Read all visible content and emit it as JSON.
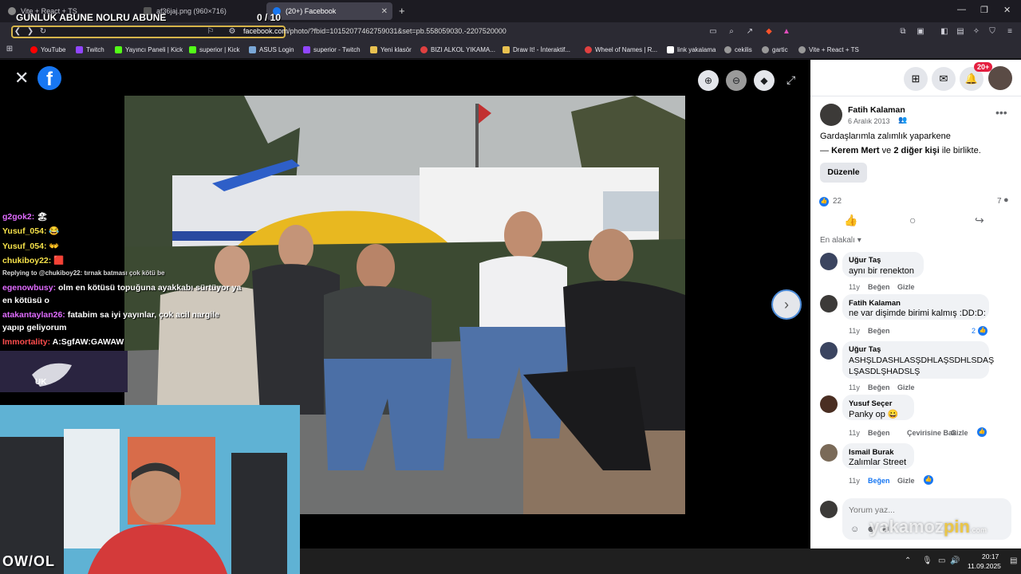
{
  "browser": {
    "tabs": [
      {
        "label": "Vite + React + TS",
        "icon": "github-icon"
      },
      {
        "label": "af36jaj.png (960×716)",
        "icon": "image-icon"
      },
      {
        "label": "(20+) Facebook",
        "icon": "facebook-icon",
        "active": true
      }
    ],
    "overlay_title": "GUNLUK ABUNE NOLRU ABUNE",
    "overlay_counter": "0  / 10",
    "url_domain": "facebook.com",
    "url_path": "/photo/?fbid=10152077462759031&set=pb.558059030.-2207520000",
    "bookmarks": [
      {
        "label": "YouTube",
        "color": "#ff0000"
      },
      {
        "label": "Twitch",
        "color": "#9146ff"
      },
      {
        "label": "Yayıncı Paneli | Kick",
        "color": "#53fc18"
      },
      {
        "label": "superior | Kick",
        "color": "#53fc18"
      },
      {
        "label": "ASUS Login",
        "color": "#7aa7d6"
      },
      {
        "label": "superior - Twitch",
        "color": "#9146ff"
      },
      {
        "label": "Yeni klasör",
        "color": "#e8c150"
      },
      {
        "label": "BIZI ALKOL YIKAMA...",
        "color": "#e04040"
      },
      {
        "label": "Draw It! - İnteraktif...",
        "color": "#e8c150"
      },
      {
        "label": "Wheel of Names | R...",
        "color": "#e04040"
      },
      {
        "label": "link yakalama",
        "color": "#ffffff"
      },
      {
        "label": "cekilis",
        "color": "#cccccc"
      },
      {
        "label": "gartic",
        "color": "#cccccc"
      },
      {
        "label": "Vite + React + TS",
        "color": "#cccccc"
      }
    ]
  },
  "chat": {
    "lines": [
      {
        "user": "g2gok2:",
        "msg": "🏖"
      },
      {
        "user": "Yusuf_054:",
        "msg": "😂"
      },
      {
        "user": "Yusuf_054:",
        "msg": "👐"
      },
      {
        "user": "chukiboy22:",
        "msg": "🟥"
      },
      {
        "user": "",
        "msg": "Replying to @chukiboy22: tırnak batması çok kötü be"
      },
      {
        "user": "egenowbusy:",
        "msg": "olm en kötüsü topuğuna ayakkabı sürtüyor ya"
      },
      {
        "user": "",
        "msg": "en kötüsü o"
      },
      {
        "user": "atakantaylan26:",
        "msg": "fatabim sa iyi yayınlar, çok acil nargile"
      },
      {
        "user": "",
        "msg": "yapıp geliyorum"
      },
      {
        "user": "Immortality:",
        "msg": "A:SgfAW:GAWAW"
      }
    ],
    "uk_label": "UK",
    "owl_label": "OW/OL"
  },
  "post": {
    "author": "Fatih Kalaman",
    "date": "6 Aralık 2013",
    "caption": "Gardaşlarımla zalımlık yaparkene",
    "tagged_prefix": "— ",
    "tagged_name": "Kerem Mert",
    "tagged_mid": " ve ",
    "tagged_others": "2 diğer kişi",
    "tagged_suffix": " ile birlikte.",
    "edit_button": "Düzenle",
    "likes": "22",
    "comments_count": "7",
    "sort_label": "En alakalı",
    "notif_badge": "20+"
  },
  "comments": [
    {
      "name": "Uğur Taş",
      "text": "aynı bir renekton",
      "time": "11y",
      "like": "Beğen",
      "hide": "Gizle"
    },
    {
      "name": "Fatih Kalaman",
      "text": "ne var dişimde birimi kalmış :DD:D:",
      "time": "11y",
      "like": "Beğen",
      "reacts": "2"
    },
    {
      "name": "Uğur Taş",
      "text": "ASHŞLDASHLASŞDHLAŞSDHLSDAŞ",
      "text2": "LŞASDLŞHADSLŞ",
      "time": "11y",
      "like": "Beğen",
      "hide": "Gizle"
    },
    {
      "name": "Yusuf Seçer",
      "text": "Panky op 😀",
      "time": "11y",
      "like": "Beğen",
      "translate": "Çevirisine Bak",
      "hide": "Gizle"
    },
    {
      "name": "Ismail Burak",
      "text": "Zalımlar Street",
      "time": "11y",
      "like": "Beğen",
      "hide": "Gizle"
    }
  ],
  "composer": {
    "placeholder": "Yorum yaz..."
  },
  "watermark": {
    "a": "yakamoz",
    "b": "pin",
    "c": ".com"
  },
  "taskbar": {
    "time": "20:17",
    "date": "11.09.2025"
  }
}
